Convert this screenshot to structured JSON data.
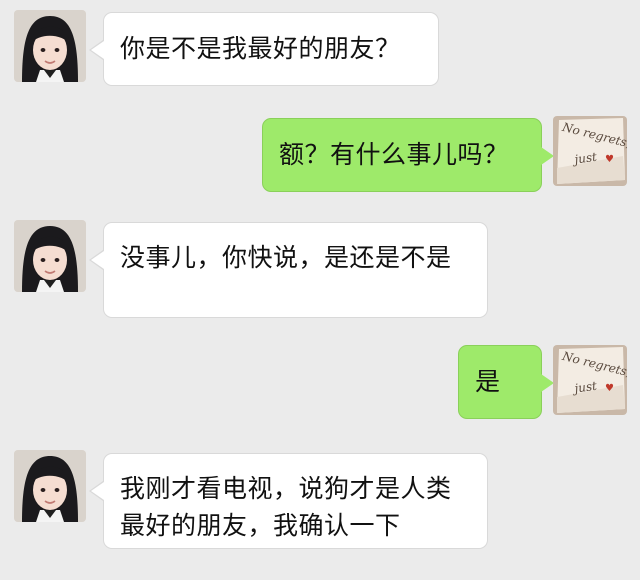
{
  "messages": [
    {
      "sender": "friend",
      "text": "你是不是我最好的朋友？"
    },
    {
      "sender": "me",
      "text": "额？有什么事儿吗？"
    },
    {
      "sender": "friend",
      "text": "没事儿，你快说，是还是不是"
    },
    {
      "sender": "me",
      "text": "是"
    },
    {
      "sender": "friend",
      "text": "我刚才看电视，说狗才是人类最好的朋友，我确认一下"
    }
  ],
  "my_avatar_text": "No regrets, just ♥",
  "colors": {
    "background": "#ebebeb",
    "incoming_bubble": "#ffffff",
    "outgoing_bubble": "#9eea6a"
  }
}
